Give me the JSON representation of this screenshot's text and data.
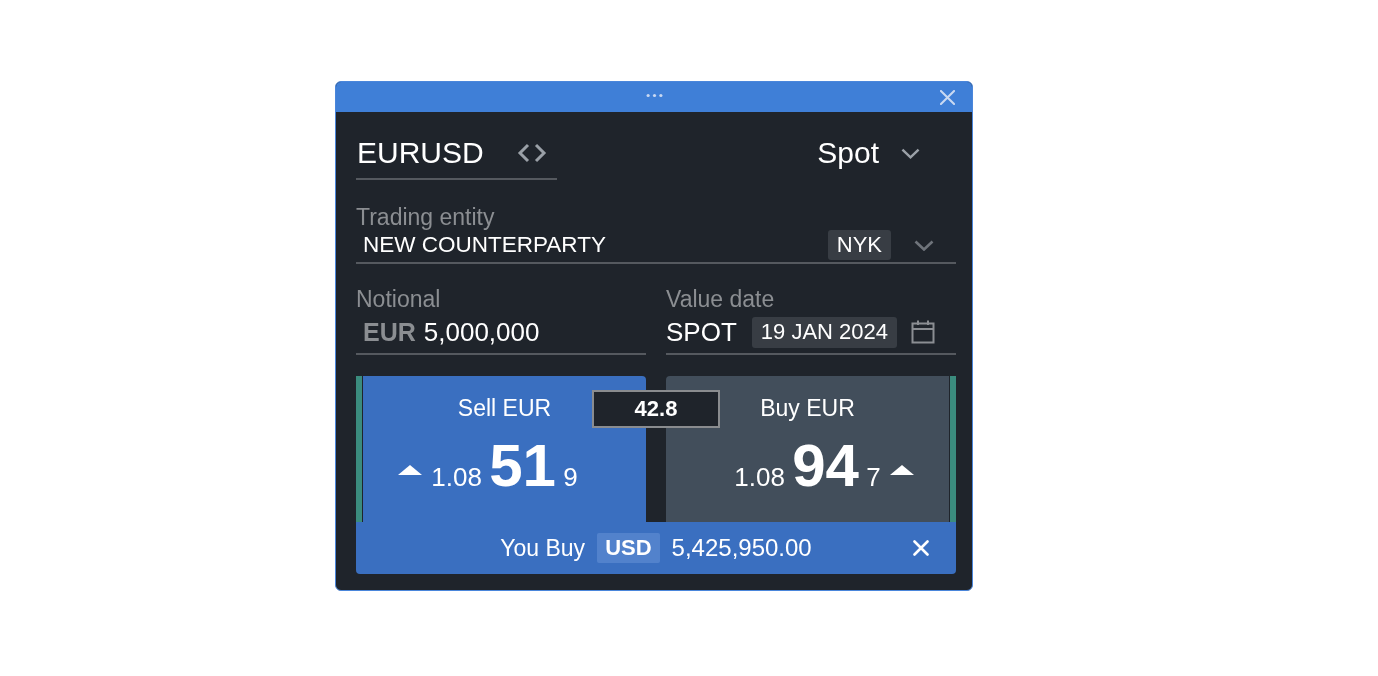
{
  "instrument": {
    "pair": "EURUSD",
    "product": "Spot"
  },
  "trading_entity": {
    "label": "Trading entity",
    "value": "NEW COUNTERPARTY",
    "location": "NYK"
  },
  "notional": {
    "label": "Notional",
    "currency": "EUR",
    "value": "5,000,000"
  },
  "value_date": {
    "label": "Value date",
    "tenor": "SPOT",
    "date": "19 JAN 2024"
  },
  "prices": {
    "spread": "42.8",
    "sides": [
      {
        "label": "Sell EUR",
        "selected": true,
        "rising": true,
        "big_figure": "1.08",
        "pips": "51",
        "fraction": "9"
      },
      {
        "label": "Buy EUR",
        "selected": false,
        "rising": true,
        "big_figure": "1.08",
        "pips": "94",
        "fraction": "7"
      }
    ]
  },
  "confirmation": {
    "action": "You Buy",
    "currency": "USD",
    "amount": "5,425,950.00"
  }
}
